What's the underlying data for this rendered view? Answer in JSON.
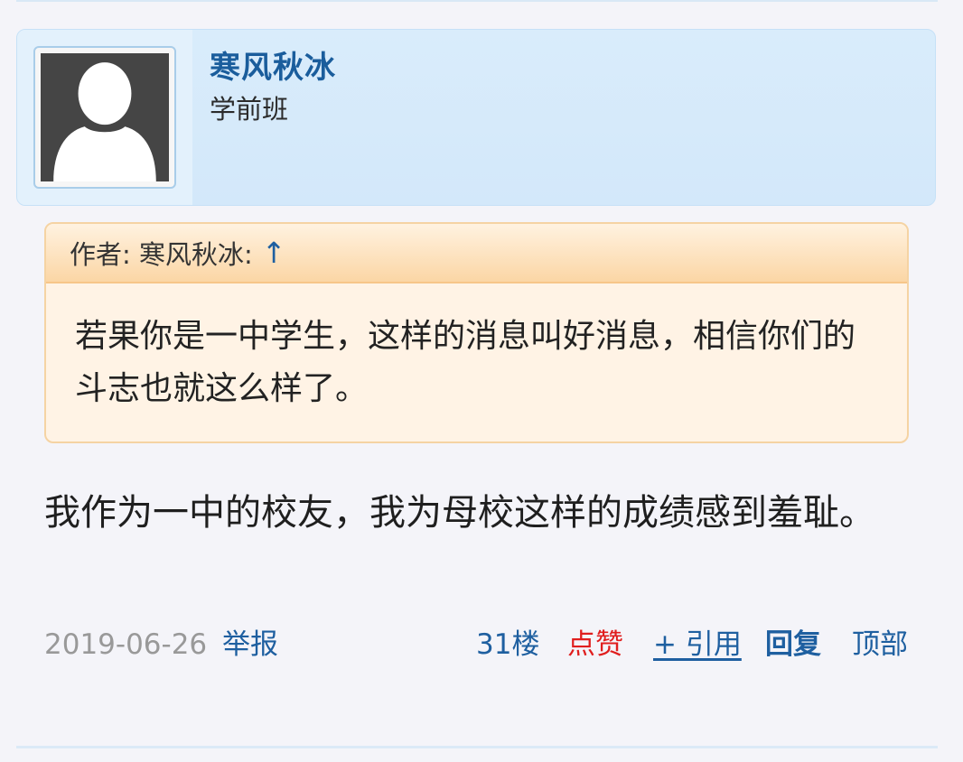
{
  "user": {
    "name": "寒风秋冰",
    "rank": "学前班"
  },
  "quote": {
    "header": "作者: 寒风秋冰:",
    "arrow": "↑",
    "text": "若果你是一中学生，这样的消息叫好消息，相信你们的斗志也就这么样了。"
  },
  "post": {
    "text": "我作为一中的校友，我为母校这样的成绩感到羞耻。"
  },
  "footer": {
    "date": "2019-06-26",
    "report": "举报",
    "floor": "31楼",
    "like": "点赞",
    "quote": "+ 引用",
    "reply": "回复",
    "top": "顶部"
  }
}
